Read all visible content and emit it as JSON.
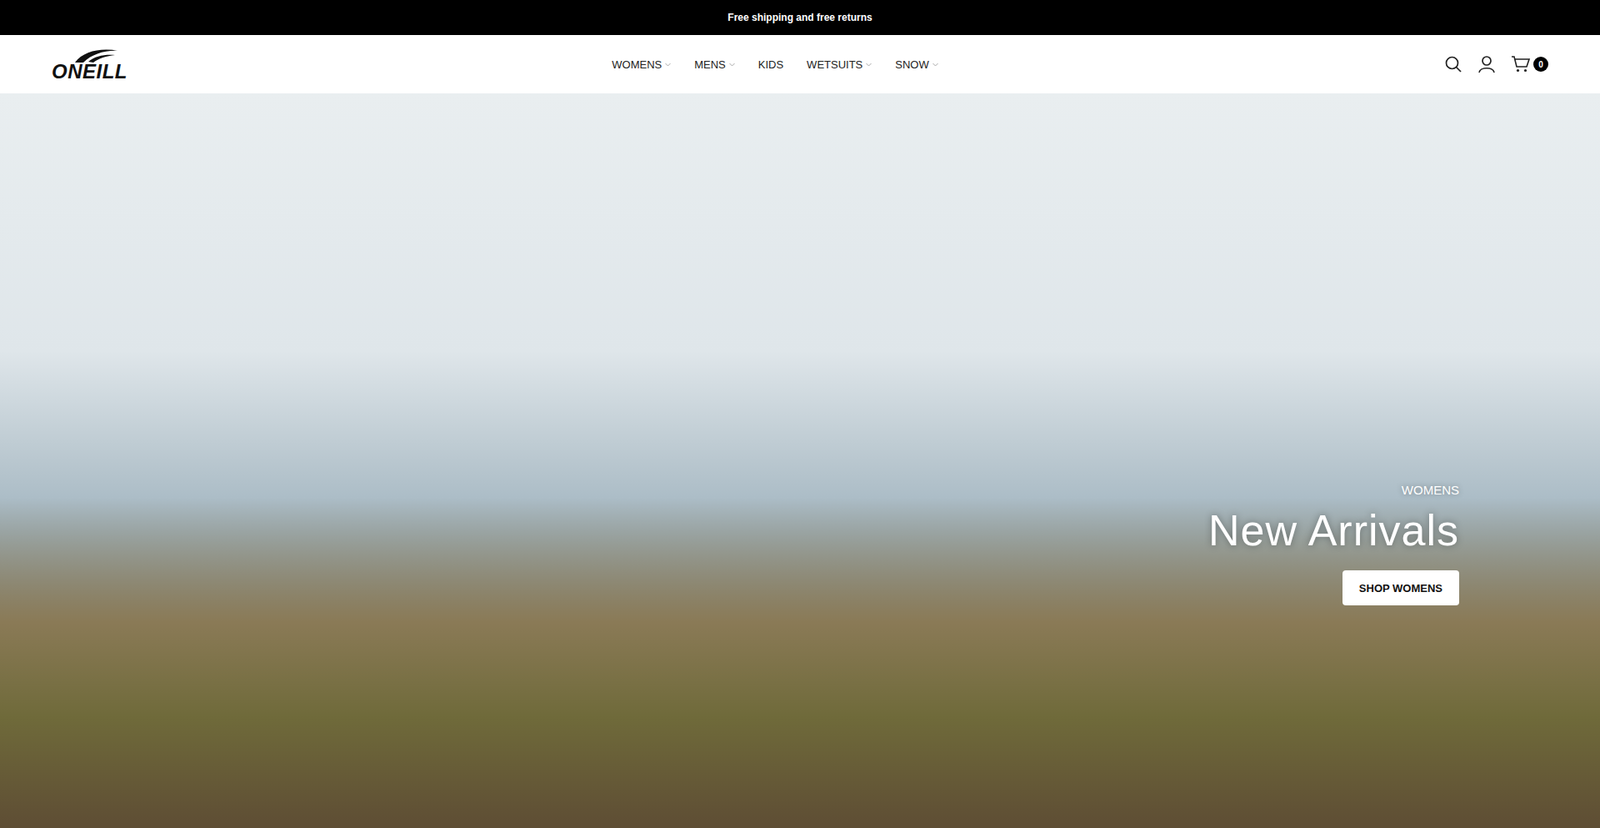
{
  "announcement": "Free shipping and free returns",
  "logo": {
    "text": "ONEILL"
  },
  "nav": [
    {
      "label": "WOMENS",
      "has_dropdown": true
    },
    {
      "label": "MENS",
      "has_dropdown": true
    },
    {
      "label": "KIDS",
      "has_dropdown": false
    },
    {
      "label": "WETSUITS",
      "has_dropdown": true
    },
    {
      "label": "SNOW",
      "has_dropdown": true
    }
  ],
  "cart": {
    "count": "0"
  },
  "hero": {
    "eyebrow": "WOMENS",
    "title": "New Arrivals",
    "button": "SHOP WOMENS"
  }
}
